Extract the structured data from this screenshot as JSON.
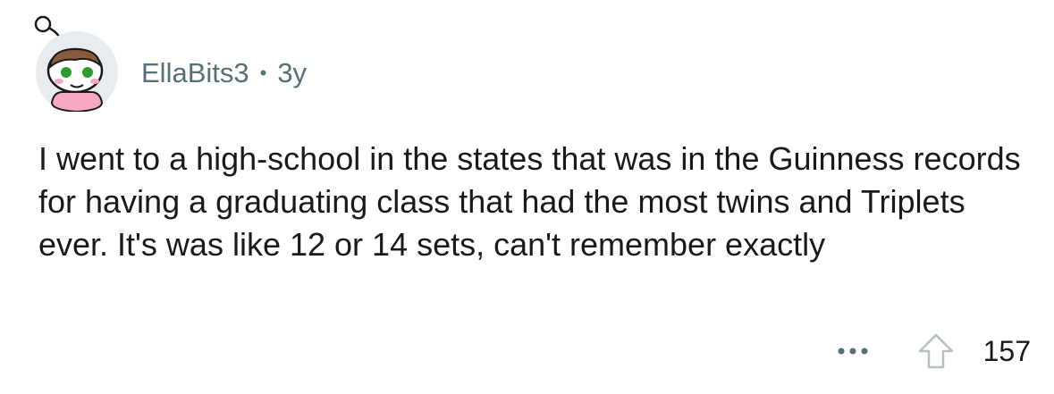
{
  "comment": {
    "author": "EllaBits3",
    "separator": "•",
    "age": "3y",
    "body": "I went to a high-school in the states that was in the Guinness records for having a graduating class that had the most twins and Triplets ever. It's was like 12 or 14 sets, can't remember exactly",
    "score": "157",
    "more_icon": "ellipsis-icon",
    "upvote_icon": "upvote-arrow-icon",
    "avatar_icon": "snoo-avatar-icon"
  },
  "colors": {
    "text": "#1a1a1b",
    "meta": "#576f76",
    "avatar_bg": "#e9ecee",
    "avatar_hair": "#8a5a3c",
    "avatar_eye": "#2e9b2e",
    "avatar_shirt": "#f7a8c0"
  }
}
